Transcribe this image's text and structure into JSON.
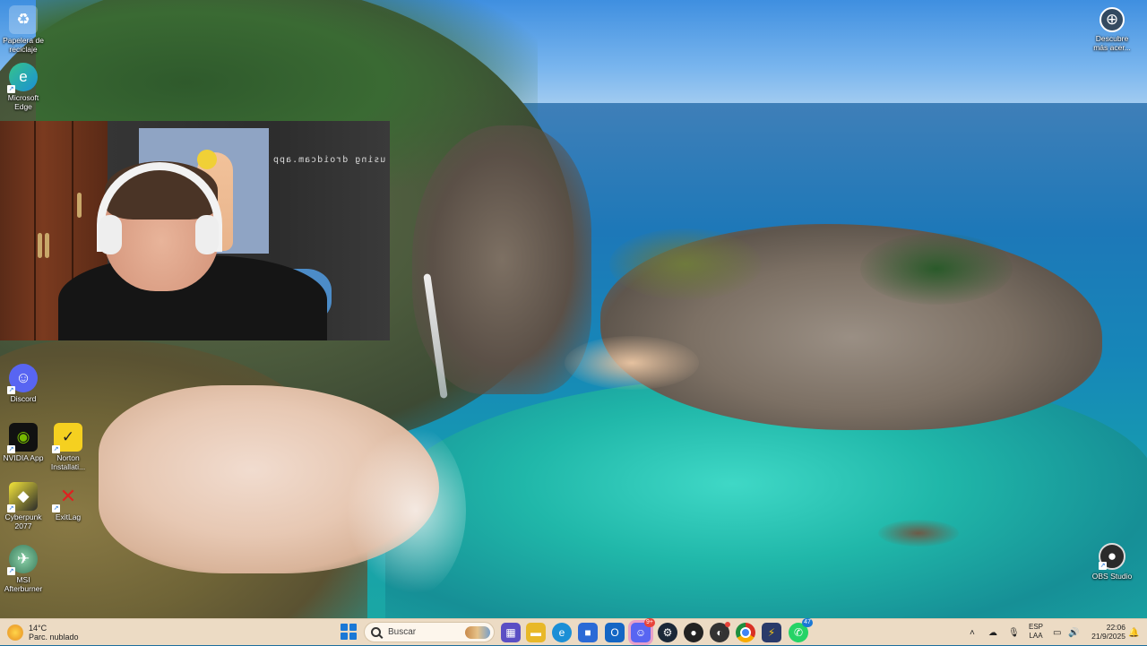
{
  "desktop": {
    "icons": [
      {
        "label": "Papelera de reciclaje",
        "icon": "recycle-bin-icon"
      },
      {
        "label": "Microsoft Edge",
        "icon": "edge-icon"
      },
      {
        "label": "Discord",
        "icon": "discord-icon"
      },
      {
        "label": "NVIDIA App",
        "icon": "nvidia-icon"
      },
      {
        "label": "Norton Installati...",
        "icon": "norton-icon"
      },
      {
        "label": "Cyberpunk 2077",
        "icon": "cyberpunk-icon"
      },
      {
        "label": "ExitLag",
        "icon": "exitlag-icon"
      },
      {
        "label": "MSI Afterburner",
        "icon": "msi-afterburner-icon"
      },
      {
        "label": "Descubre más acer...",
        "icon": "discover-icon"
      },
      {
        "label": "OBS Studio",
        "icon": "obs-icon"
      }
    ]
  },
  "webcam": {
    "overlay_text": "using droidcam.app"
  },
  "taskbar": {
    "weather": {
      "temp": "14°C",
      "condition": "Parc. nublado"
    },
    "search": {
      "placeholder": "Buscar"
    },
    "apps": [
      {
        "name": "Microsoft Store preview",
        "icon": "store-preview-icon",
        "color": "#5b4fc4"
      },
      {
        "name": "File Explorer",
        "icon": "folder-icon",
        "color": "#e8b828"
      },
      {
        "name": "Microsoft Edge",
        "icon": "edge-icon",
        "color": "#1b8fd6"
      },
      {
        "name": "Microsoft Store",
        "icon": "store-icon",
        "color": "#2b6ad6"
      },
      {
        "name": "Outlook",
        "icon": "outlook-icon",
        "color": "#1466c4"
      },
      {
        "name": "Discord",
        "icon": "discord-icon",
        "color": "#5865f2",
        "badge": "9+"
      },
      {
        "name": "Steam",
        "icon": "steam-icon",
        "color": "#1b2838"
      },
      {
        "name": "App",
        "icon": "circle-app-icon",
        "color": "#222222"
      },
      {
        "name": "App with notification",
        "icon": "chat-app-icon",
        "color": "#333333"
      },
      {
        "name": "Google Chrome",
        "icon": "chrome-icon",
        "color": "#d93025"
      },
      {
        "name": "Manager",
        "icon": "manager-icon",
        "color": "#2a3a6a"
      },
      {
        "name": "WhatsApp",
        "icon": "whatsapp-icon",
        "color": "#25d366",
        "badge": "47"
      }
    ],
    "language": {
      "line1": "ESP",
      "line2": "LAA"
    },
    "clock": {
      "time": "22:06",
      "date": "21/9/2025"
    }
  },
  "colors": {
    "taskbar_bg": "#ecdbc4",
    "accent": "#1a78d6"
  }
}
